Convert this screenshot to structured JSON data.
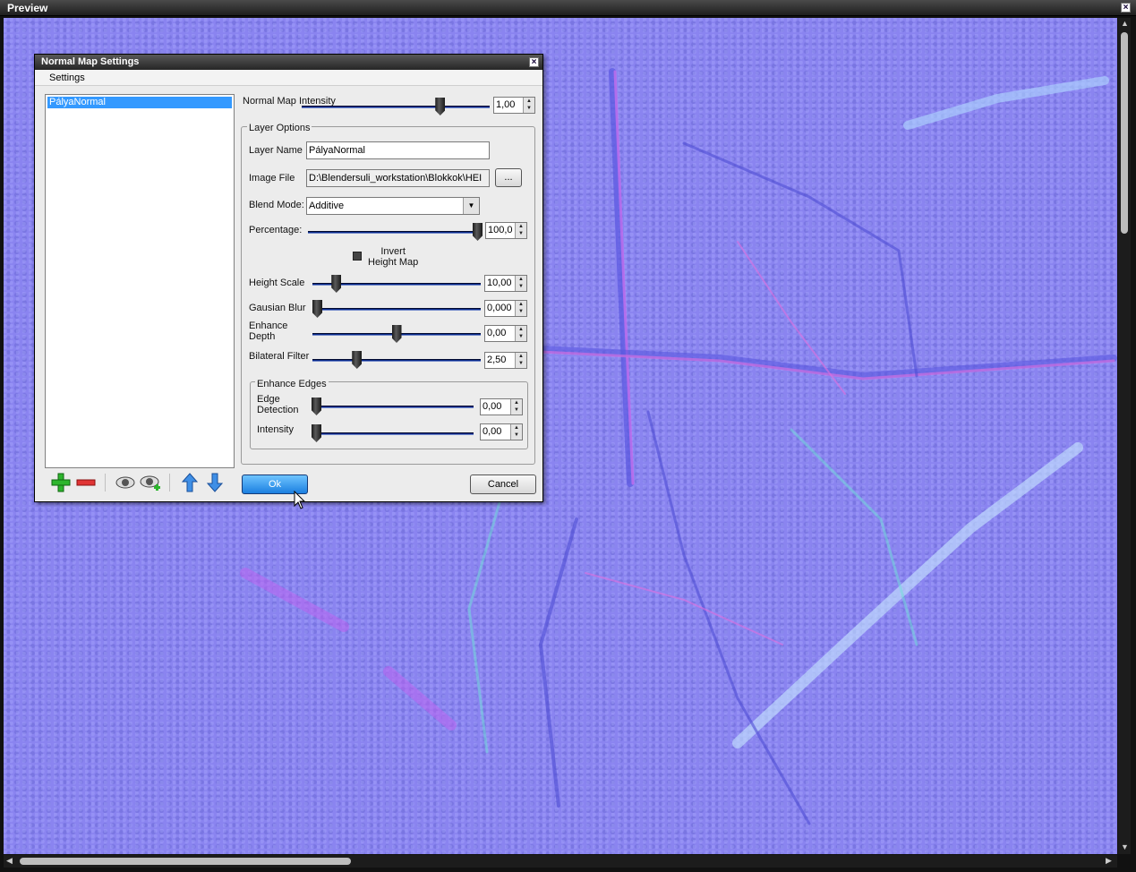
{
  "window": {
    "title": "Preview"
  },
  "dialog": {
    "title": "Normal Map Settings",
    "menu": [
      "Settings"
    ],
    "layers": [
      "PályaNormal"
    ],
    "intensity": {
      "label": "Normal Map Intensity",
      "value": "1,00",
      "level": 0.75
    },
    "layer_options": {
      "title": "Layer Options",
      "layer_name_label": "Layer Name",
      "layer_name": "PályaNormal",
      "image_file_label": "Image File",
      "image_file": "D:\\Blendersuli_workstation\\Blokkok\\HEI",
      "browse_label": "...",
      "blend_mode_label": "Blend Mode:",
      "blend_mode": "Additive",
      "percentage": {
        "label": "Percentage:",
        "value": "100,0",
        "level": 1.0
      },
      "invert_label": "Invert\nHeight Map",
      "height_scale": {
        "label": "Height Scale",
        "value": "10,00",
        "level": 0.12
      },
      "gausian_blur": {
        "label": "Gausian Blur",
        "value": "0,000",
        "level": 0.0
      },
      "enhance_depth": {
        "label": "Enhance\nDepth",
        "value": "0,00",
        "level": 0.5
      },
      "bilateral_filter": {
        "label": "Bilateral Filter",
        "value": "2,50",
        "level": 0.25
      }
    },
    "enhance_edges": {
      "title": "Enhance Edges",
      "edge_detection": {
        "label": "Edge\nDetection",
        "value": "0,00",
        "level": 0.0
      },
      "intensity": {
        "label": "Intensity",
        "value": "0,00",
        "level": 0.0
      }
    },
    "ok_label": "Ok",
    "cancel_label": "Cancel"
  },
  "icons": [
    "add-layer-icon",
    "remove-layer-icon",
    "eye-icon",
    "eye-add-icon",
    "move-up-icon",
    "move-down-icon"
  ]
}
